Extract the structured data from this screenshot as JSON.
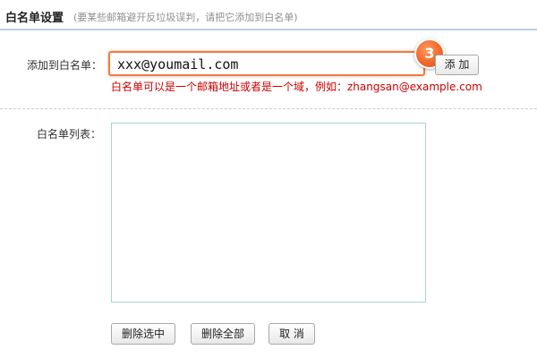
{
  "header": {
    "title": "白名单设置",
    "subtitle": "(要某些邮箱避开反垃圾误判，请把它添加到白名单)"
  },
  "add_section": {
    "label": "添加到白名单：",
    "input_value": "xxx@youmail.com",
    "step_badge": "3",
    "add_button": "添 加",
    "hint": "白名单可以是一个邮箱地址或者是一个域，例如：zhangsan@example.com"
  },
  "list_section": {
    "label": "白名单列表：",
    "items": []
  },
  "actions": {
    "delete_selected": "删除选中",
    "delete_all": "删除全部",
    "cancel": "取 消"
  },
  "colors": {
    "header_border": "#b7d1e6",
    "input_focus_border": "#f07b42",
    "badge": "#f2682c",
    "hint": "#cc0000",
    "list_border": "#a9d4cf"
  }
}
